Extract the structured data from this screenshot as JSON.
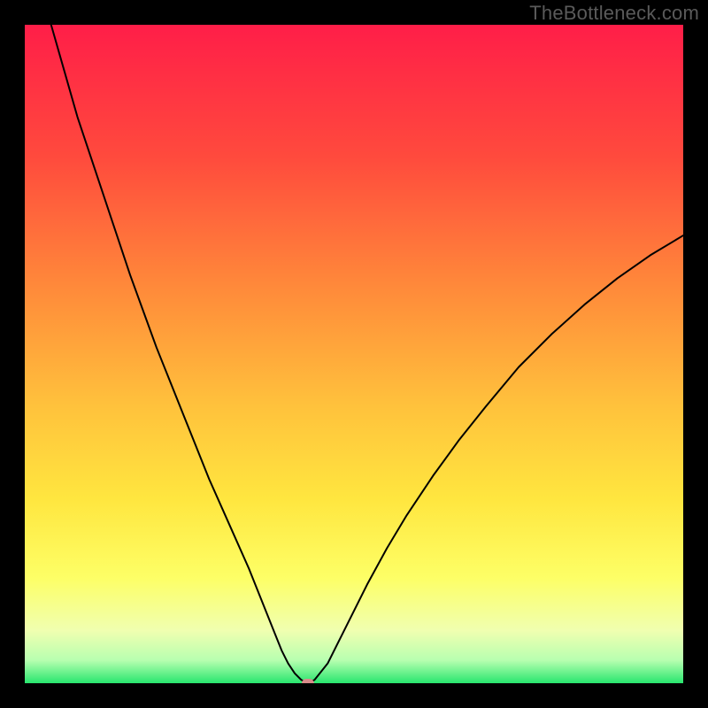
{
  "watermark": "TheBottleneck.com",
  "chart_data": {
    "type": "line",
    "title": "",
    "xlabel": "",
    "ylabel": "",
    "xlim": [
      0,
      100
    ],
    "ylim": [
      0,
      100
    ],
    "grid": false,
    "legend": false,
    "background": {
      "type": "vertical-gradient",
      "stops": [
        {
          "pos": 0.0,
          "color": "#ff1e48"
        },
        {
          "pos": 0.2,
          "color": "#ff4a3d"
        },
        {
          "pos": 0.4,
          "color": "#ff8a3a"
        },
        {
          "pos": 0.58,
          "color": "#ffc23c"
        },
        {
          "pos": 0.72,
          "color": "#ffe63f"
        },
        {
          "pos": 0.84,
          "color": "#fdff66"
        },
        {
          "pos": 0.92,
          "color": "#f0ffb0"
        },
        {
          "pos": 0.965,
          "color": "#b8ffb0"
        },
        {
          "pos": 1.0,
          "color": "#28e66e"
        }
      ]
    },
    "series": [
      {
        "name": "bottleneck-curve",
        "color": "#000000",
        "stroke_width": 2,
        "x": [
          4,
          6,
          8,
          10,
          12,
          14,
          16,
          18,
          20,
          22,
          24,
          26,
          28,
          30,
          32,
          34,
          35,
          36,
          37,
          38,
          39,
          40,
          41,
          42,
          43,
          44,
          46,
          48,
          50,
          52,
          55,
          58,
          62,
          66,
          70,
          75,
          80,
          85,
          90,
          95,
          100
        ],
        "y": [
          100,
          93,
          86,
          80,
          74,
          68,
          62,
          56.5,
          51,
          46,
          41,
          36,
          31,
          26.5,
          22,
          17.5,
          15,
          12.5,
          10,
          7.5,
          5,
          3,
          1.5,
          0.5,
          0,
          0.5,
          3,
          7,
          11,
          15,
          20.5,
          25.5,
          31.5,
          37,
          42,
          48,
          53,
          57.5,
          61.5,
          65,
          68
        ]
      }
    ],
    "marker": {
      "name": "optimum-marker",
      "x": 43,
      "y": 0,
      "color": "#d98a8a",
      "rx": 7,
      "ry": 5
    },
    "frame": {
      "color": "#000000",
      "thickness_px": 28
    }
  }
}
